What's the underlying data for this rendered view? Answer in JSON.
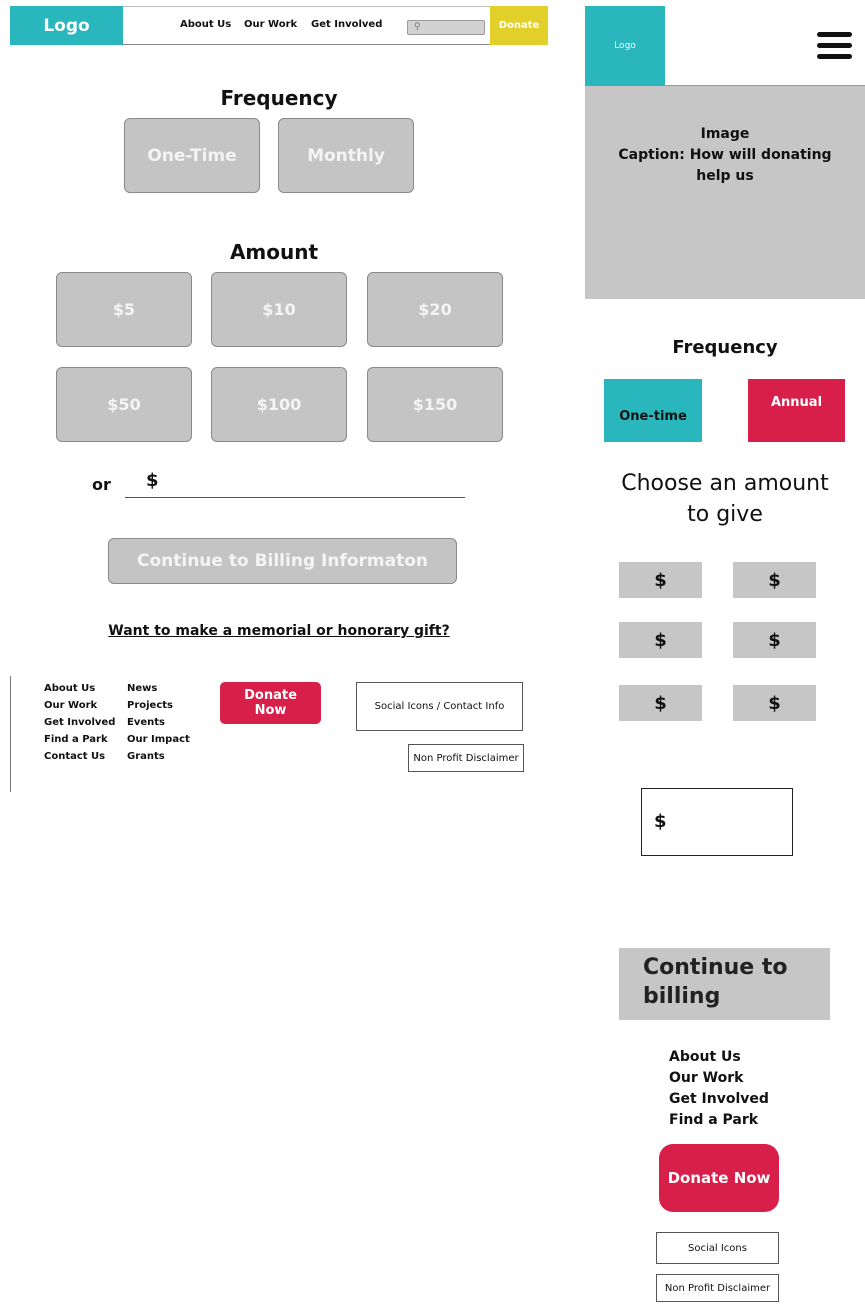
{
  "desktop": {
    "header": {
      "logo": "Logo",
      "nav": [
        "About Us",
        "Our Work",
        "Get Involved"
      ],
      "donate": "Donate"
    },
    "frequency": {
      "title": "Frequency",
      "options": [
        "One-Time",
        "Monthly"
      ]
    },
    "amount": {
      "title": "Amount",
      "options": [
        "$5",
        "$10",
        "$20",
        "$50",
        "$100",
        "$150"
      ],
      "or_label": "or",
      "currency": "$"
    },
    "continue_button": "Continue to Billing Informaton",
    "memorial_link": "Want to make a memorial or honorary gift?",
    "footer": {
      "col1": [
        "About Us",
        "Our Work",
        "Get Involved",
        "Find a Park",
        "Contact Us"
      ],
      "col2": [
        "News",
        "Projects",
        "Events",
        "Our Impact",
        "Grants"
      ],
      "donate_now": "Donate Now",
      "social": "Social Icons / Contact Info",
      "disclaimer": "Non Profit Disclaimer"
    }
  },
  "mobile": {
    "header": {
      "logo": "Logo"
    },
    "image": {
      "line1": "Image",
      "line2": "Caption: How will donating",
      "line3": "help us"
    },
    "frequency": {
      "title": "Frequency",
      "one_time": "One-time",
      "annual": "Annual"
    },
    "amount": {
      "title_line1": "Choose an amount",
      "title_line2": "to give",
      "options": [
        "$",
        "$",
        "$",
        "$",
        "$",
        "$"
      ],
      "custom": "$"
    },
    "continue_line1": "Continue to",
    "continue_line2": "billing",
    "footer": {
      "links": [
        "About Us",
        "Our Work",
        "Get Involved",
        "Find a Park"
      ],
      "donate_now": "Donate Now",
      "social": "Social Icons",
      "disclaimer": "Non Profit Disclaimer"
    }
  },
  "colors": {
    "teal": "#29b6bd",
    "crimson": "#d81f4a",
    "yellow": "#e2cf2a",
    "gray": "#c4c4c4"
  }
}
